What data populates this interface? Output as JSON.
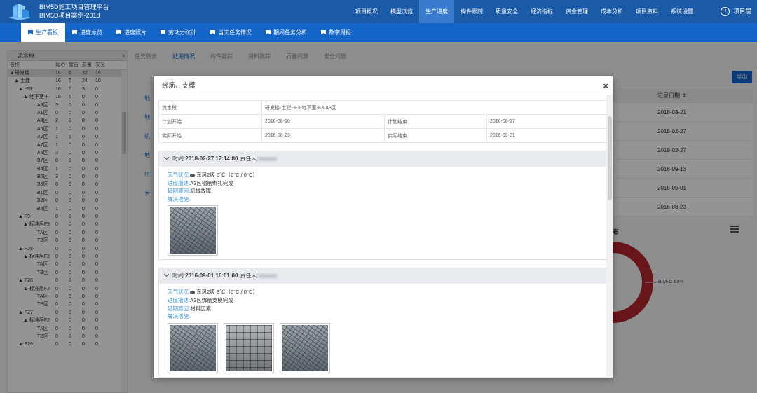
{
  "header": {
    "line1": "BIM5D施工项目管理平台",
    "line2": "BIM5D项目案例-2018",
    "nav": [
      "项目概况",
      "模型浏览",
      "生产进度",
      "构件跟踪",
      "质量安全",
      "经济指标",
      "资金管理",
      "成本分析",
      "项目资料",
      "系统设置"
    ],
    "active_nav": "生产进度",
    "user": "项目层"
  },
  "subnav": [
    "生产看板",
    "进度总览",
    "进度照片",
    "劳动力统计",
    "当天任务情况",
    "期间任务分析",
    "数字周报"
  ],
  "tree": {
    "title": "流水段",
    "columns": [
      "名称",
      "延迟",
      "警告",
      "质量",
      "安全"
    ],
    "rows": [
      {
        "name": "▲研发楼",
        "v": [
          "16",
          "6",
          "32",
          "16"
        ]
      },
      {
        "name": "▲ 土建",
        "v": [
          "16",
          "6",
          "24",
          "10"
        ]
      },
      {
        "name": "▲ -F3",
        "v": [
          "16",
          "6",
          "3",
          "0"
        ]
      },
      {
        "name": "▲ 地下室-F",
        "v": [
          "16",
          "6",
          "0",
          "0"
        ]
      },
      {
        "name": "A3区",
        "v": [
          "3",
          "5",
          "0",
          "0"
        ]
      },
      {
        "name": "A1区",
        "v": [
          "0",
          "0",
          "0",
          "0"
        ]
      },
      {
        "name": "A4区",
        "v": [
          "2",
          "0",
          "0",
          "0"
        ]
      },
      {
        "name": "A5区",
        "v": [
          "1",
          "0",
          "0",
          "0"
        ]
      },
      {
        "name": "A2区",
        "v": [
          "1",
          "1",
          "0",
          "0"
        ]
      },
      {
        "name": "A7区",
        "v": [
          "1",
          "0",
          "0",
          "0"
        ]
      },
      {
        "name": "A6区",
        "v": [
          "3",
          "0",
          "0",
          "0"
        ]
      },
      {
        "name": "B7区",
        "v": [
          "0",
          "0",
          "0",
          "0"
        ]
      },
      {
        "name": "B4区",
        "v": [
          "1",
          "0",
          "0",
          "0"
        ]
      },
      {
        "name": "B5区",
        "v": [
          "3",
          "0",
          "0",
          "0"
        ]
      },
      {
        "name": "B6区",
        "v": [
          "0",
          "0",
          "0",
          "0"
        ]
      },
      {
        "name": "B1区",
        "v": [
          "0",
          "0",
          "0",
          "0"
        ]
      },
      {
        "name": "B2区",
        "v": [
          "0",
          "0",
          "0",
          "0"
        ]
      },
      {
        "name": "B3区",
        "v": [
          "1",
          "0",
          "0",
          "0"
        ]
      },
      {
        "name": "▲ F9",
        "v": [
          "0",
          "0",
          "0",
          "0"
        ]
      },
      {
        "name": "▲ 标准层F9",
        "v": [
          "0",
          "0",
          "0",
          "0"
        ]
      },
      {
        "name": "TA区",
        "v": [
          "0",
          "0",
          "0",
          "0"
        ]
      },
      {
        "name": "TB区",
        "v": [
          "0",
          "0",
          "0",
          "0"
        ]
      },
      {
        "name": "▲ F29",
        "v": [
          "0",
          "0",
          "0",
          "0"
        ]
      },
      {
        "name": "▲ 标准层F2",
        "v": [
          "0",
          "0",
          "0",
          "0"
        ]
      },
      {
        "name": "TA区",
        "v": [
          "0",
          "0",
          "0",
          "0"
        ]
      },
      {
        "name": "TB区",
        "v": [
          "0",
          "0",
          "0",
          "0"
        ]
      },
      {
        "name": "▲ F28",
        "v": [
          "0",
          "0",
          "0",
          "0"
        ]
      },
      {
        "name": "▲ 标准层F2",
        "v": [
          "0",
          "0",
          "0",
          "0"
        ]
      },
      {
        "name": "TA区",
        "v": [
          "0",
          "0",
          "0",
          "0"
        ]
      },
      {
        "name": "TB区",
        "v": [
          "0",
          "0",
          "0",
          "0"
        ]
      },
      {
        "name": "▲ F27",
        "v": [
          "0",
          "0",
          "0",
          "0"
        ]
      },
      {
        "name": "▲ 标准层F2",
        "v": [
          "0",
          "0",
          "0",
          "0"
        ]
      },
      {
        "name": "TA区",
        "v": [
          "0",
          "0",
          "0",
          "0"
        ]
      },
      {
        "name": "TB区",
        "v": [
          "0",
          "0",
          "0",
          "0"
        ]
      },
      {
        "name": "▲ F26",
        "v": [
          "0",
          "0",
          "0",
          "0"
        ]
      }
    ]
  },
  "main": {
    "tabs": [
      "任务列表",
      "延期情况",
      "构件跟踪",
      "资料跟踪",
      "质量问题",
      "安全问题"
    ],
    "active_tab": "延期情况",
    "export_label": "导出",
    "date_header": "记录日期 ⇕",
    "dates": [
      "2018-03-21",
      "2018-02-27",
      "2018-02-27",
      "2016-09-13",
      "2016-09-01",
      "2016-08-23"
    ],
    "left_links": [
      "地",
      "地",
      "机",
      "地",
      "材",
      "天"
    ],
    "dist_label": "布",
    "legend_label": "BIM-1: 50%"
  },
  "modal": {
    "title": "绑筋、支模",
    "info": {
      "segment_label": "流水段",
      "segment_value": "研发楼-土建--F3-地下室-F3-A3区",
      "plan_start_label": "计划开始",
      "plan_start_value": "2016-08-16",
      "plan_end_label": "计划结束",
      "plan_end_value": "2016-08-17",
      "actual_start_label": "实际开始",
      "actual_start_value": "2016-08-23",
      "actual_end_label": "实际结束",
      "actual_end_value": "2016-09-01"
    },
    "records": [
      {
        "time_prefix": "时间:",
        "time": "2018-02-27 17:14:00",
        "person_label": "责任人:",
        "weather_label": "天气状况:",
        "weather": "东风2级 6℃（6°C / 0°C）",
        "desc_label": "进度描述:",
        "desc": "A3区钢筋绑扎完成",
        "delay_label": "延期原因:",
        "delay": "机械故障",
        "solution_label": "解决措施:",
        "solution": "",
        "photo_count": 1
      },
      {
        "time_prefix": "时间:",
        "time": "2016-09-01 16:01:00",
        "person_label": "责任人:",
        "weather_label": "天气状况:",
        "weather": "东风2级 8℃（6°C / 0°C）",
        "desc_label": "进度描述:",
        "desc": "A3区绑筋支模完成",
        "delay_label": "延期原因:",
        "delay": "材料因素",
        "solution_label": "解决措施:",
        "solution": "",
        "photo_count": 3
      }
    ]
  },
  "colors": {
    "header_bg": "#1a5aa7",
    "subnav_bg": "#1465c8",
    "label_blue": "#3d8fd6",
    "donut_red": "#b3262e"
  }
}
